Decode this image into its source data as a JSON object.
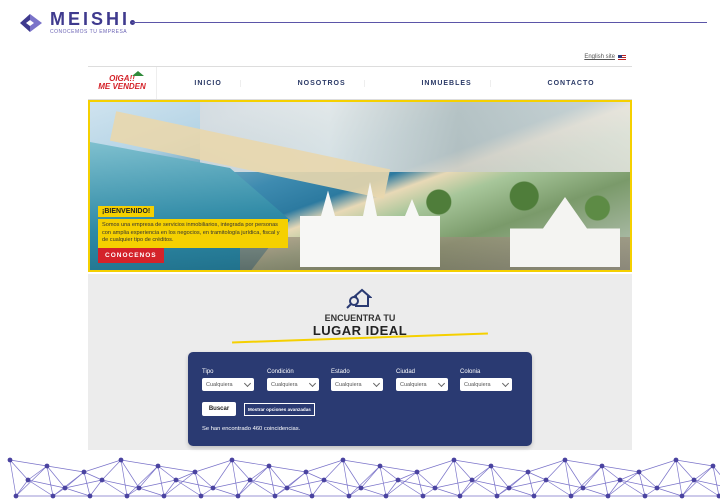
{
  "brand": {
    "name": "MEISHI",
    "tagline": "CONOCEMOS TU EMPRESA"
  },
  "site": {
    "language_link": "English site",
    "logo": {
      "line1": "OIGA!!",
      "line2": "ME VENDEN"
    },
    "nav": [
      {
        "label": "INICIO"
      },
      {
        "label": "NOSOTROS"
      },
      {
        "label": "INMUEBLES"
      },
      {
        "label": "CONTACTO"
      }
    ],
    "hero": {
      "title": "¡BIENVENIDO!",
      "text": "Somos una empresa de servicios inmobiliarios, integrada por personas con amplia experiencia en los negocios, en tramitología jurídica, fiscal y de cualquier tipo de créditos.",
      "button": "CONOCENOS"
    },
    "finder": {
      "title_line1": "ENCUENTRA TU",
      "title_line2": "LUGAR IDEAL",
      "fields": [
        {
          "label": "Tipo",
          "value": "Cualquiera"
        },
        {
          "label": "Condición",
          "value": "Cualquiera"
        },
        {
          "label": "Estado",
          "value": "Cualquiera"
        },
        {
          "label": "Ciudad",
          "value": "Cualquiera"
        },
        {
          "label": "Colonia",
          "value": "Cualquiera"
        }
      ],
      "search_button": "Buscar",
      "advanced_button": "Mostrar opciones avanzadas",
      "result_text": "Se han encontrado 460 coincidencias."
    }
  },
  "colors": {
    "brand": "#3f3a8e",
    "accent_yellow": "#f5d000",
    "accent_red": "#d4232a",
    "panel_blue": "#2a3a72"
  }
}
